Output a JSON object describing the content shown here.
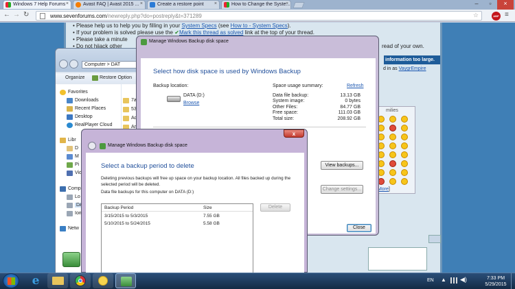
{
  "browser": {
    "tabs": [
      {
        "label": "Windows 7 Help Forums",
        "active": true
      },
      {
        "label": "Avast FAQ | Avast 2015 ..."
      },
      {
        "label": "Create a restore point"
      },
      {
        "label": "How to Change the Syste..."
      }
    ],
    "url_prefix": "www.sevenforums.com",
    "url_path": "/newreply.php?do=postreply&t=371289",
    "abp_label": "ABP"
  },
  "forum": {
    "lines": [
      "Please help us to help you by filling in your",
      "If your problem is solved please use the",
      "Please take a minute",
      "Do not hijack other"
    ],
    "line1_link1": "System Specs",
    "line1_text2": "(see",
    "line1_link2": "How to - System Specs",
    "line1_text3": ").",
    "line2_check": "Mark this thread as solved",
    "line2_tail": "link at the top of your thread.",
    "line4_tail": "read of your own.",
    "info_banner": "information too large.",
    "replied_prefix": "d in as",
    "replied_user": "VaygrEmpire",
    "smilies_label": "milies",
    "more_label": "More"
  },
  "explorer": {
    "breadcrumb": "Computer > DAT",
    "organize": "Organize",
    "restore_options": "Restore Option",
    "favorites": [
      {
        "label": "Favorites"
      },
      {
        "label": "Downloads"
      },
      {
        "label": "Recent Places"
      },
      {
        "label": "Desktop"
      },
      {
        "label": "RealPlayer Cloud"
      }
    ],
    "libraries": [
      {
        "label": "Libr"
      },
      {
        "label": "D"
      },
      {
        "label": "M"
      },
      {
        "label": "Pi"
      },
      {
        "label": "Vid"
      }
    ],
    "computer": [
      {
        "label": "Comp"
      },
      {
        "label": "Lo"
      },
      {
        "label": "DAT"
      },
      {
        "label": "Iom"
      },
      {
        "label": "Netw"
      }
    ],
    "folders": [
      "7a",
      "53",
      "Ad",
      "Ar"
    ]
  },
  "manage_dialog": {
    "title": "Manage Windows Backup disk space",
    "heading": "Select how disk space is used by Windows Backup",
    "backup_location_label": "Backup location:",
    "drive_name": "DATA (D:)",
    "browse": "Browse",
    "summary_label": "Space usage summary:",
    "refresh": "Refresh",
    "summary": [
      {
        "label": "Data file backup:",
        "value": "13.13 GB"
      },
      {
        "label": "System image:",
        "value": "0 bytes"
      },
      {
        "label": "Other Files:",
        "value": "84.77 GB"
      },
      {
        "label": "Free space:",
        "value": "111.03 GB"
      },
      {
        "label": "Total size:",
        "value": "208.92 GB"
      }
    ],
    "view_backups": "View backups...",
    "change_settings": "Change settings...",
    "close": "Close"
  },
  "select_dialog": {
    "title": "Manage Windows Backup disk space",
    "heading": "Select a backup period to delete",
    "desc1": "Deleting previous backups will free up space on your backup location. All files backed up during the",
    "desc2": "selected period will be deleted.",
    "desc3": "Data file backups for this computer on DATA (D:)",
    "col_period": "Backup Period",
    "col_size": "Size",
    "rows": [
      {
        "period": "3/15/2015 to 5/3/2015",
        "size": "7.55 GB"
      },
      {
        "period": "5/10/2015 to 5/24/2015",
        "size": "5.58 GB"
      }
    ],
    "delete": "Delete",
    "close_x": "x"
  },
  "taskbar": {
    "lang": "EN",
    "time": "7:33 PM",
    "date": "5/29/2015"
  },
  "colors": {
    "desktop": "#2a6db8",
    "taskbar": "#1b3a5c",
    "dialog_title": "#1f4e9a",
    "aero_frame": "#c6b4d8"
  }
}
